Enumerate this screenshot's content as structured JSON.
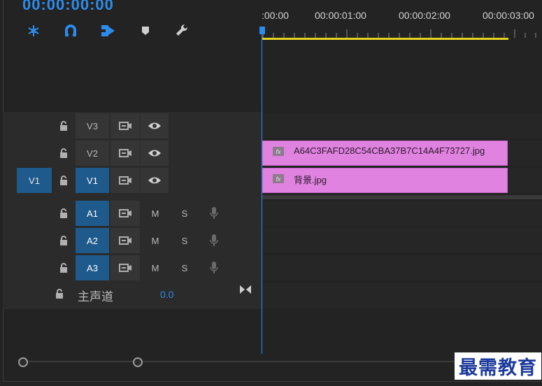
{
  "timecode": "00:00:00:00",
  "ruler": {
    "labels": [
      ":00:00",
      "00:00:01:00",
      "00:00:02:00",
      "00:00:03:00"
    ]
  },
  "toolbar": {
    "icons": [
      "snap-in-sequence-icon",
      "linked-selection-icon",
      "insert-edit-icon",
      "add-marker-icon",
      "timeline-settings-wrench-icon"
    ]
  },
  "tracks": {
    "video": [
      {
        "target": "V3",
        "source": ""
      },
      {
        "target": "V2",
        "source": ""
      },
      {
        "target": "V1",
        "source": "V1"
      }
    ],
    "audio": [
      {
        "target": "A1",
        "mute": "M",
        "solo": "S"
      },
      {
        "target": "A2",
        "mute": "M",
        "solo": "S"
      },
      {
        "target": "A3",
        "mute": "M",
        "solo": "S"
      }
    ]
  },
  "master": {
    "label": "主声道",
    "value": "0.0"
  },
  "clips": [
    {
      "track": "V2",
      "name": "A64C3FAFD28C54CBA37B7C14A4F73727.jpg",
      "fx": "fx"
    },
    {
      "track": "V1",
      "name": "背景.jpg",
      "fx": "fx"
    }
  ],
  "colors": {
    "accent": "#2d8ceb",
    "clip": "#e082e0",
    "work_area": "#e3d31c",
    "track_target": "#1e5a8c"
  },
  "watermark": "最需教育"
}
